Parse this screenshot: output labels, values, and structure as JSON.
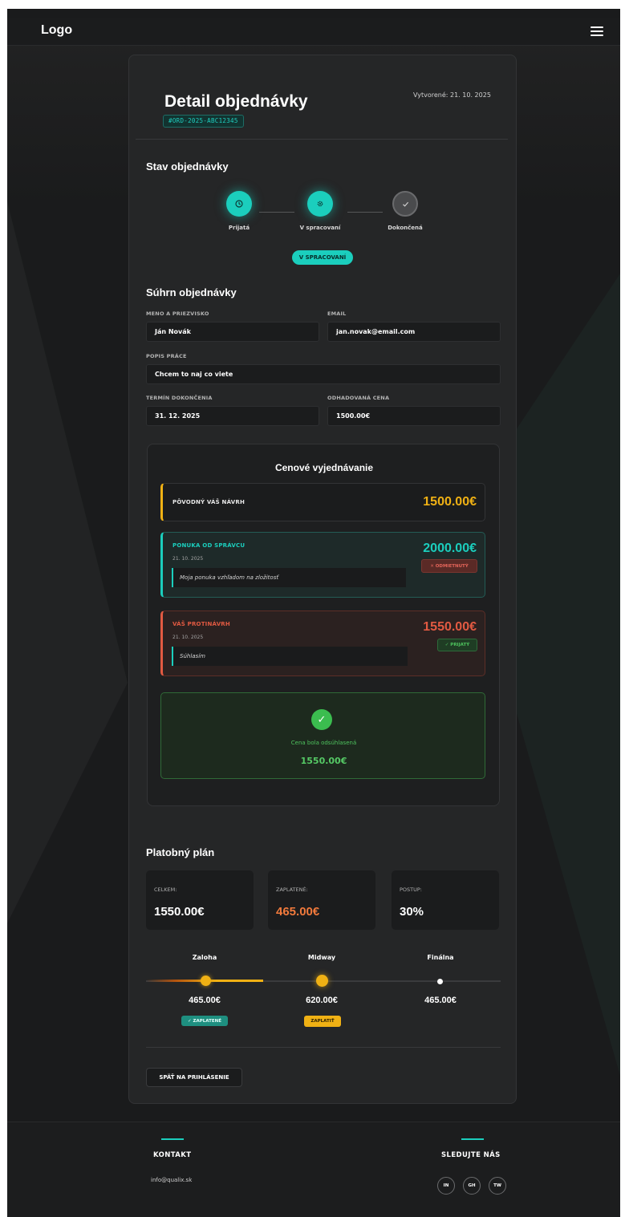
{
  "nav": {
    "logo": "Logo"
  },
  "header": {
    "title": "Detail objednávky",
    "order_code": "#ORD-2025-ABC12345",
    "created": "Vytvorené: 21. 10. 2025"
  },
  "status": {
    "heading": "Stav objednávky",
    "steps": [
      {
        "label": "Prijatá",
        "icon": "clock-icon",
        "state": "done"
      },
      {
        "label": "V spracovaní",
        "icon": "gear-icon",
        "state": "active"
      },
      {
        "label": "Dokončená",
        "icon": "check-icon",
        "state": "pending"
      }
    ],
    "pill": "V SPRACOVANÍ"
  },
  "summary": {
    "heading": "Súhrn objednávky",
    "name_label": "MENO A PRIEZVISKO",
    "name_value": "Ján Novák",
    "email_label": "EMAIL",
    "email_value": "jan.novak@email.com",
    "desc_label": "POPIS PRÁCE",
    "desc_value": "Chcem to naj co viete",
    "deadline_label": "TERMÍN DOKONČENIA",
    "deadline_value": "31. 12. 2025",
    "price_label": "ODHADOVANÁ CENA",
    "price_value": "1500.00€"
  },
  "negotiation": {
    "heading": "Cenové vyjednávanie",
    "original": {
      "label": "PÔVODNÝ VÁŠ NÁVRH",
      "amount": "1500.00€"
    },
    "admin_offer": {
      "label": "PONUKA OD SPRÁVCU",
      "date": "21. 10. 2025",
      "note": "Moja ponuka vzhľadom na zložitosť",
      "amount": "2000.00€",
      "badge": "✕ ODMIETNUTÝ"
    },
    "counter_offer": {
      "label": "VÁŠ PROTINÁVRH",
      "date": "21. 10. 2025",
      "note": "Súhlasím",
      "amount": "1550.00€",
      "badge": "✓ PRIJATÝ"
    },
    "agreed": {
      "text": "Cena bola odsúhlasená",
      "amount": "1550.00€"
    }
  },
  "payment": {
    "heading": "Platobný plán",
    "total_label": "CELKEM:",
    "total_value": "1550.00€",
    "paid_label": "ZAPLATENÉ:",
    "paid_value": "465.00€",
    "progress_label": "POSTUP:",
    "progress_value": "30%",
    "progress_fraction": 0.3,
    "milestones": [
      {
        "title": "Zaloha",
        "amount": "465.00€",
        "badge": "✓ ZAPLATENÉ",
        "state": "paid"
      },
      {
        "title": "Midway",
        "amount": "620.00€",
        "badge": "ZAPLATIŤ",
        "state": "due"
      },
      {
        "title": "Finálna",
        "amount": "465.00€",
        "badge": "",
        "state": "pending"
      }
    ]
  },
  "actions": {
    "back": "SPÄŤ NA PRIHLÁSENIE"
  },
  "footer": {
    "contact_heading": "KONTAKT",
    "email": "info@qualix.sk",
    "follow_heading": "SLEDUJTE NÁS",
    "social": [
      "IN",
      "GH",
      "TW"
    ]
  },
  "colors": {
    "accent": "#1bcebd",
    "gold": "#f0b114",
    "orange": "#f27a3c",
    "red": "#e25a42",
    "green": "#55c965"
  }
}
